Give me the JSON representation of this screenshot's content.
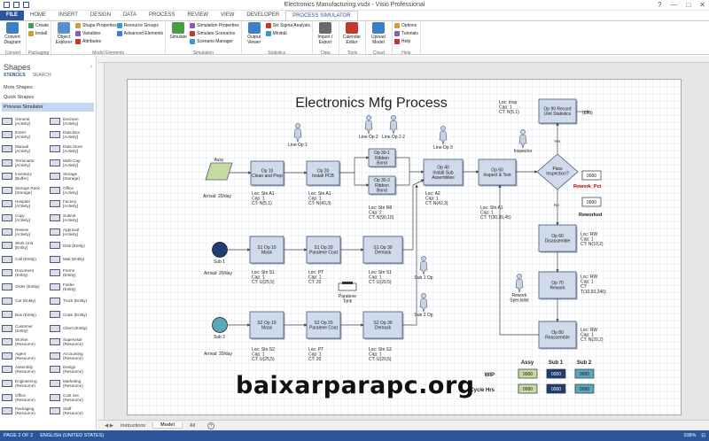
{
  "window": {
    "title": "Electronics Manufacturing.vsdx - Visio Professional",
    "controls": [
      "?",
      "—",
      "□",
      "✕"
    ]
  },
  "tabs": [
    "FILE",
    "HOME",
    "INSERT",
    "DESIGN",
    "DATA",
    "PROCESS",
    "REVIEW",
    "VIEW",
    "DEVELOPER",
    "PROCESS SIMULATOR"
  ],
  "active_tab": "PROCESS SIMULATOR",
  "ribbon": {
    "groups": [
      {
        "label": "Convert",
        "big": [
          {
            "label": "Convert Diagram",
            "color": "#3c7fc8"
          }
        ],
        "small": []
      },
      {
        "label": "Packaging",
        "big": [],
        "small": [
          "Create",
          "Install"
        ]
      },
      {
        "label": "Model Elements",
        "big": [
          {
            "label": "Object Explorer",
            "color": "#5a8fcf"
          }
        ],
        "small": [
          "Shape Properties",
          "Variables",
          "Attributes",
          "Resource Groups",
          "Advanced Elements"
        ]
      },
      {
        "label": "Simulation",
        "big": [
          {
            "label": "Simulate",
            "color": "#4a9a4a"
          }
        ],
        "small": [
          "Simulation Properties",
          "Simulate Scenarios",
          "Scenario Manager"
        ]
      },
      {
        "label": "Statistics",
        "big": [
          {
            "label": "Output Viewer",
            "color": "#3c7fc8"
          }
        ],
        "small": [
          "Six Sigma Analysis",
          "Minitab"
        ]
      },
      {
        "label": "Data",
        "big": [
          {
            "label": "Import / Export",
            "color": "#6a6a6a"
          }
        ],
        "small": []
      },
      {
        "label": "Tools",
        "big": [
          {
            "label": "Calendar Editor",
            "color": "#c0392b"
          }
        ],
        "small": []
      },
      {
        "label": "Cloud",
        "big": [
          {
            "label": "Upload Model",
            "color": "#3c7fc8"
          }
        ],
        "small": []
      },
      {
        "label": "Help",
        "big": [],
        "small": [
          "Options",
          "Tutorials",
          "Help"
        ]
      }
    ]
  },
  "shapes_panel": {
    "title": "Shapes",
    "nav": [
      "STENCILS",
      "SEARCH"
    ],
    "more_shapes": "More Shapes",
    "quick_shapes": "Quick Shapes",
    "active_stencil": "Process Simulator",
    "items": [
      [
        "General",
        "[Activity]"
      ],
      [
        "Decision",
        "[Activity]"
      ],
      [
        "Event",
        "[Activity]"
      ],
      [
        "Data Box",
        "[Activity]"
      ],
      [
        "Manual",
        "[Activity]"
      ],
      [
        "Data Store",
        "[Activity]"
      ],
      [
        "Terminator",
        "[Activity]"
      ],
      [
        "Multi-Cap",
        "[Activity]"
      ],
      [
        "Inventory",
        "[Buffer]"
      ],
      [
        "Storage",
        "[Storage]"
      ],
      [
        "Storage Rack",
        "[Storage]"
      ],
      [
        "Office",
        "[Activity]"
      ],
      [
        "Hospital",
        "[Activity]"
      ],
      [
        "Factory",
        "[Activity]"
      ],
      [
        "Copy",
        "[Activity]"
      ],
      [
        "Submit",
        "[Activity]"
      ],
      [
        "Review",
        "[Activity]"
      ],
      [
        "Approval",
        "[Activity]"
      ],
      [
        "Work Unit",
        "[Entity]"
      ],
      [
        "Disk (Entity)",
        ""
      ],
      [
        "Call (Entity)",
        ""
      ],
      [
        "Mail (Entity)",
        ""
      ],
      [
        "Document",
        "(Entity)"
      ],
      [
        "Forms",
        "(Entity)"
      ],
      [
        "Order (Entity)",
        ""
      ],
      [
        "Folder",
        "(Entity)"
      ],
      [
        "Car (Entity)",
        ""
      ],
      [
        "Truck (Entity)",
        ""
      ],
      [
        "Box (Entity)",
        ""
      ],
      [
        "Crate (Entity)",
        ""
      ],
      [
        "Customer",
        "(Entity)"
      ],
      [
        "Client (Entity)",
        ""
      ],
      [
        "Worker",
        "(Resource)"
      ],
      [
        "Supervisor",
        "(Resource)"
      ],
      [
        "Agent",
        "(Resource)"
      ],
      [
        "Accounting",
        "(Resource)"
      ],
      [
        "Assembly",
        "(Resource)"
      ],
      [
        "Design",
        "(Resource)"
      ],
      [
        "Engineering",
        "(Resource)"
      ],
      [
        "Marketing",
        "(Resource)"
      ],
      [
        "Office",
        "(Resource)"
      ],
      [
        "Cust Svc",
        "(Resource)"
      ],
      [
        "Packaging",
        "(Resource)"
      ],
      [
        "Staff",
        "(Resource)"
      ]
    ]
  },
  "diagram": {
    "title": "Electronics Mfg Process",
    "assy": {
      "label": "Assy",
      "arrival": "Arrival: 20/day"
    },
    "sub1": {
      "label": "Sub 1",
      "arrival": "Arrival: 20/day"
    },
    "sub2": {
      "label": "Sub 2",
      "arrival": "Arrival: 20/day"
    },
    "activities": {
      "op10": {
        "name": "Op 10\nClean and Prep",
        "loc": "Loc: Stn A1",
        "cap": "Cap: 1",
        "ct": "CT: N(5,1)"
      },
      "op20": {
        "name": "Op 20\nInstall PCB",
        "loc": "Loc: Stn A1",
        "cap": "Cap: 1",
        "ct": "CT: N(40,3)"
      },
      "op301": {
        "name": "Op 30-1\nRibbon\nBond"
      },
      "op302": {
        "name": "Op 30-2\nRibbon\nBond",
        "loc": "Loc: Stn R8",
        "cap": "Cap: 2",
        "ct": "CT: N(90,10)"
      },
      "op40": {
        "name": "Op 40\nInstall Sub\nAssemblies",
        "loc": "Loc: A2",
        "cap": "Cap: 1",
        "ct": "CT: N(42,3)"
      },
      "op50": {
        "name": "Op 50\nInspect & Test",
        "loc": "Loc: Stn A1",
        "cap": "Cap: 1",
        "ct": "CT: T(30,35,45)"
      },
      "op90": {
        "name": "Op 90 Record\nUnit Statistics",
        "loc": "Loc: Insp",
        "cap": "Cap: 1",
        "ct": "CT: N(5,1)"
      },
      "pass": {
        "name": "Pass\nInspection?",
        "yes": "Yes",
        "no": "No"
      },
      "op60": {
        "name": "Op 60\nDisassemble",
        "loc": "Loc: RW",
        "cap": "Cap: 1",
        "ct": "CT: N(10,2)"
      },
      "op70": {
        "name": "Op 70\nRework",
        "loc": "Loc: RW",
        "cap": "Cap: 1",
        "ct": "CT:",
        "ct2": "T(10,60,240)"
      },
      "op80": {
        "name": "Op 80\nReassemble",
        "loc": "Loc: RW",
        "cap": "Cap: 1",
        "ct": "CT: N(20,2)"
      },
      "s1op10": {
        "name": "S1 Op 10\nMask",
        "loc": "Loc: Stn S1",
        "cap": "Cap: 1",
        "ct": "CT: U(25,5)"
      },
      "s1op20": {
        "name": "S1 Op 20\nParalene Coat",
        "loc": "Loc: PT",
        "cap": "Cap: 1",
        "ct": "CT: 20"
      },
      "s1op30": {
        "name": "S1 Op 30\nDemask",
        "loc": "Loc: Stn S1",
        "cap": "Cap: 1",
        "ct": "CT: U(20,5)"
      },
      "s2op10": {
        "name": "S2 Op 10\nMask",
        "loc": "Loc: Stn S2",
        "cap": "Cap: 1",
        "ct": "CT: U(25,5)"
      },
      "s2op20": {
        "name": "S2 Op 20\nParalene Coat",
        "loc": "Loc: PT",
        "cap": "Cap: 1",
        "ct": "CT: 20"
      },
      "s2op30": {
        "name": "S2 Op 30\nDemask",
        "loc": "Loc: Stn S2",
        "cap": "Cap: 1",
        "ct": "CT: U(20,5)"
      }
    },
    "resources": {
      "lineop1": "Line Op 1",
      "lineop2": "Line Op 2",
      "lineop22": "Line Op 2.2",
      "lineop3": "Line Op 3",
      "inspector": "Inspector",
      "sub1op": "Sub 1 Op",
      "sub2op": "Sub 2 Op",
      "rework": "Rework\nSpecialist",
      "paralene": "Paralene\nTank"
    },
    "exit_label": "(Exit)",
    "rework_pct": {
      "value": "0000",
      "label": "Rework_Pct"
    },
    "reworked": {
      "value": "0000",
      "label": "Reworked"
    },
    "stats": {
      "columns": [
        "Assy",
        "Sub 1",
        "Sub 2"
      ],
      "rows": [
        {
          "label": "WIP",
          "values": [
            "0000",
            "0000",
            "0000"
          ]
        },
        {
          "label": "Cycle Hrs",
          "values": [
            "0000",
            "0000",
            "0000"
          ]
        }
      ],
      "colors": [
        "#c6dba0",
        "#1f3d70",
        "#5aa9b8"
      ]
    }
  },
  "watermark": "baixarparapc.org",
  "page_tabs": [
    "Instructions",
    "Model",
    "All"
  ],
  "active_page_tab": "Model",
  "status": {
    "page": "PAGE 2 OF 2",
    "language": "ENGLISH (UNITED STATES)",
    "zoom": "108%"
  }
}
